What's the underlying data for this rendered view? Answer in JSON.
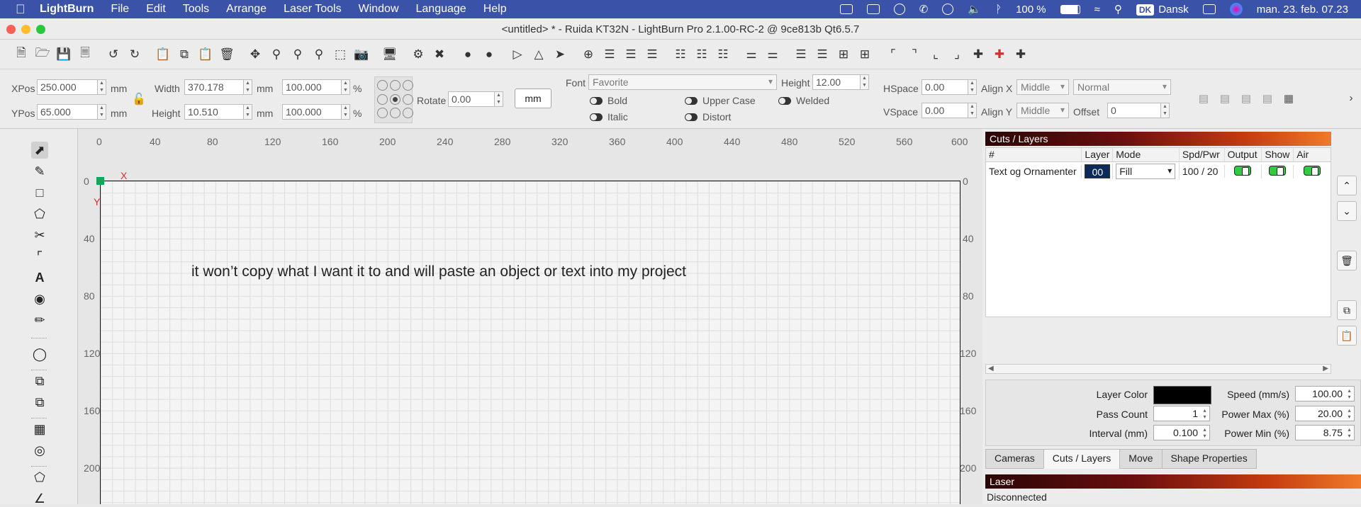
{
  "menubar": {
    "app": "LightBurn",
    "items": [
      "File",
      "Edit",
      "Tools",
      "Arrange",
      "Laser Tools",
      "Window",
      "Language",
      "Help"
    ],
    "battery": "100 %",
    "keyboard_badge": "DK",
    "keyboard_lang": "Dansk",
    "datetime": "man. 23. feb. 07.23"
  },
  "window": {
    "title": "<untitled> * - Ruida KT32N - LightBurn Pro 2.1.00-RC-2 @ 9ce813b Qt6.5.7"
  },
  "props": {
    "xpos_label": "XPos",
    "xpos": "250.000",
    "ypos_label": "YPos",
    "ypos": "65.000",
    "unit": "mm",
    "width_label": "Width",
    "width": "370.178",
    "height_label": "Height",
    "height": "10.510",
    "scale_w": "100.000",
    "scale_h": "100.000",
    "percent": "%",
    "rotate_label": "Rotate",
    "rotate": "0.00",
    "unit_button": "mm",
    "font_label": "Font",
    "font": "Favorite",
    "font_height_label": "Height",
    "font_height": "12.00",
    "hspace_label": "HSpace",
    "hspace": "0.00",
    "vspace_label": "VSpace",
    "vspace": "0.00",
    "alignx_label": "Align X",
    "alignx": "Middle",
    "aligny_label": "Align Y",
    "aligny": "Middle",
    "style": "Normal",
    "offset_label": "Offset",
    "offset": "0",
    "bold": "Bold",
    "italic": "Italic",
    "upper": "Upper Case",
    "distort": "Distort",
    "welded": "Welded"
  },
  "rulers": {
    "top": [
      "0",
      "40",
      "80",
      "120",
      "160",
      "200",
      "240",
      "280",
      "320",
      "360",
      "400",
      "440",
      "480",
      "520",
      "560",
      "600"
    ],
    "left": [
      "0",
      "40",
      "80",
      "120",
      "160",
      "200"
    ],
    "right": [
      "0",
      "40",
      "80",
      "120",
      "160",
      "200"
    ]
  },
  "canvas": {
    "text": "it won’t copy what I want it to and will paste an object or text into my project",
    "axis_x": "X",
    "axis_y": "Y"
  },
  "layers_panel": {
    "title": "Cuts / Layers",
    "columns": [
      "#",
      "Layer",
      "Mode",
      "Spd/Pwr",
      "Output",
      "Show",
      "Air"
    ],
    "rows": [
      {
        "name": "Text og Ornamenter",
        "layer": "00",
        "mode": "Fill",
        "spd_pwr": "100 / 20",
        "layer_color": "#0b2a5a"
      }
    ]
  },
  "layer_settings": {
    "layer_color_label": "Layer Color",
    "layer_color": "#000000",
    "pass_count_label": "Pass Count",
    "pass_count": "1",
    "interval_label": "Interval (mm)",
    "interval": "0.100",
    "speed_label": "Speed (mm/s)",
    "speed": "100.00",
    "power_max_label": "Power Max (%)",
    "power_max": "20.00",
    "power_min_label": "Power Min (%)",
    "power_min": "8.75"
  },
  "tabs": [
    "Cameras",
    "Cuts / Layers",
    "Move",
    "Shape Properties"
  ],
  "laser_panel": {
    "title": "Laser",
    "status": "Disconnected"
  }
}
